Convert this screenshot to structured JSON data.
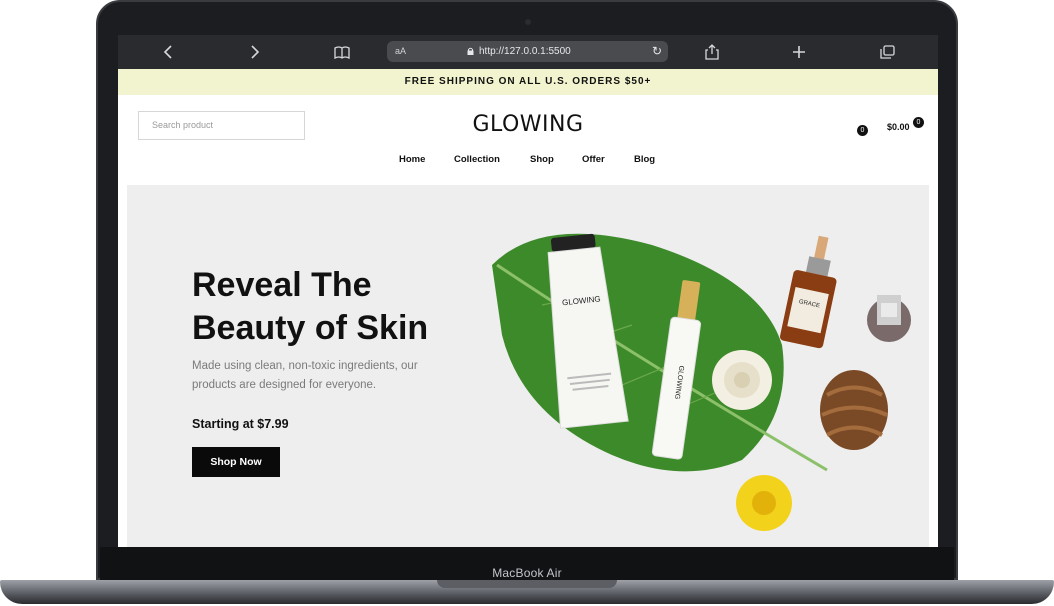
{
  "device": {
    "label": "MacBook Air"
  },
  "browser": {
    "text_size": "aA",
    "url": "http://127.0.0.1:5500",
    "icons": [
      "chevron-left-icon",
      "chevron-right-icon",
      "book-icon",
      "lock-icon",
      "reload-icon",
      "share-icon",
      "plus-icon",
      "tabs-icon"
    ]
  },
  "announcement": "FREE SHIPPING ON ALL U.S. ORDERS $50+",
  "header": {
    "search_placeholder": "Search product",
    "logo": "GLOWING",
    "wishlist_count": "0",
    "cart_total": "$0.00",
    "cart_count": "0"
  },
  "nav": [
    "Home",
    "Collection",
    "Shop",
    "Offer",
    "Blog"
  ],
  "hero": {
    "title_line1": "Reveal The",
    "title_line2": "Beauty of Skin",
    "description": "Made using clean, non-toxic ingredients, our products are designed for everyone.",
    "price_text": "Starting at $7.99",
    "cta": "Shop Now",
    "product_label": "GLOWING",
    "bottle_label": "GRACE"
  },
  "colors": {
    "announcement_bg": "#f2f4cf",
    "hero_bg": "#eeeeee",
    "button_bg": "#0a0a0a"
  }
}
